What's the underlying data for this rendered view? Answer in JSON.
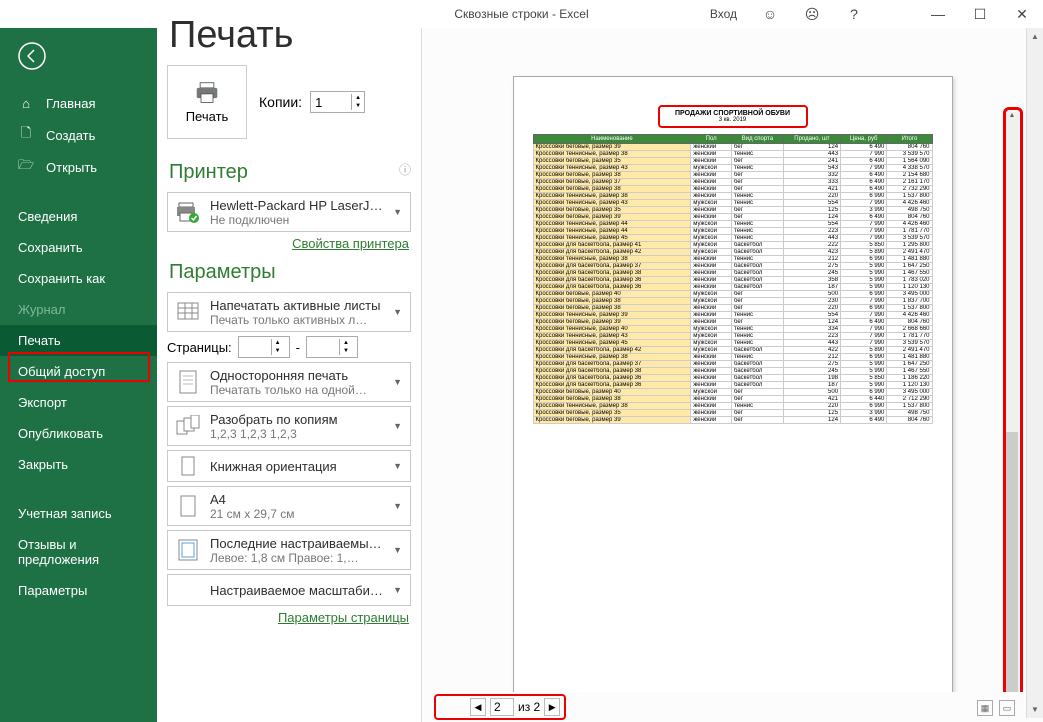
{
  "titlebar": {
    "title": "Сквозные строки - Excel",
    "login": "Вход"
  },
  "sidebar": {
    "home": "Главная",
    "new": "Создать",
    "open": "Открыть",
    "info": "Сведения",
    "save": "Сохранить",
    "saveas": "Сохранить как",
    "history": "Журнал",
    "print": "Печать",
    "share": "Общий доступ",
    "export": "Экспорт",
    "publish": "Опубликовать",
    "close": "Закрыть",
    "account": "Учетная запись",
    "feedback": "Отзывы и предложения",
    "options": "Параметры"
  },
  "page": {
    "title": "Печать"
  },
  "print": {
    "button": "Печать",
    "copies_label": "Копии:",
    "copies": "1"
  },
  "printer_section": "Принтер",
  "printer": {
    "name": "Hewlett-Packard HP LaserJe…",
    "status": "Не подключен",
    "props": "Свойства принтера"
  },
  "params_section": "Параметры",
  "active_sheets": {
    "l1": "Напечатать активные листы",
    "l2": "Печать только активных л…"
  },
  "pages": {
    "label": "Страницы:",
    "dash": "-"
  },
  "one_sided": {
    "l1": "Односторонняя печать",
    "l2": "Печатать только на одной…"
  },
  "collate": {
    "l1": "Разобрать по копиям",
    "l2": "1,2,3   1,2,3   1,2,3"
  },
  "orientation": {
    "l1": "Книжная ориентация"
  },
  "paper": {
    "l1": "A4",
    "l2": "21 см x 29,7 см"
  },
  "margins": {
    "l1": "Последние настраиваемы…",
    "l2": "Левое: 1,8 см  Правое: 1,…"
  },
  "scaling": {
    "l1": "Настраиваемое масштаби…"
  },
  "page_setup_link": "Параметры страницы",
  "preview": {
    "title": "ПРОДАЖИ СПОРТИВНОЙ ОБУВИ",
    "subtitle": "3 кв. 2019",
    "headers": [
      "Наименование",
      "Пол",
      "Вид спорта",
      "Продано, шт",
      "Цена, руб",
      "Итого"
    ],
    "rows": [
      [
        "Кроссовки беговые, размер 39",
        "женский",
        "бег",
        "124",
        "6 490",
        "804 760"
      ],
      [
        "Кроссовки теннисные, размер 38",
        "женский",
        "теннис",
        "443",
        "7 990",
        "3 539 570"
      ],
      [
        "Кроссовки беговые, размер 35",
        "женский",
        "бег",
        "241",
        "6 490",
        "1 564 090"
      ],
      [
        "Кроссовки теннисные, размер 43",
        "мужской",
        "теннис",
        "543",
        "7 990",
        "4 338 570"
      ],
      [
        "Кроссовки беговые, размер 38",
        "женский",
        "бег",
        "332",
        "6 490",
        "2 154 680"
      ],
      [
        "Кроссовки беговые, размер 37",
        "женский",
        "бег",
        "333",
        "6 490",
        "2 161 170"
      ],
      [
        "Кроссовки беговые, размер 38",
        "женский",
        "бег",
        "421",
        "6 490",
        "2 732 290"
      ],
      [
        "Кроссовки теннисные, размер 38",
        "женский",
        "теннис",
        "220",
        "6 990",
        "1 537 800"
      ],
      [
        "Кроссовки теннисные, размер 43",
        "мужской",
        "теннис",
        "554",
        "7 990",
        "4 426 460"
      ],
      [
        "Кроссовки беговые, размер 35",
        "женский",
        "бег",
        "125",
        "3 990",
        "498 750"
      ],
      [
        "Кроссовки беговые, размер 39",
        "женский",
        "бег",
        "124",
        "6 490",
        "804 760"
      ],
      [
        "Кроссовки теннисные, размер 44",
        "мужской",
        "теннис",
        "554",
        "7 990",
        "4 426 460"
      ],
      [
        "Кроссовки теннисные, размер 44",
        "мужской",
        "теннис",
        "223",
        "7 990",
        "1 781 770"
      ],
      [
        "Кроссовки теннисные, размер 45",
        "мужской",
        "теннис",
        "443",
        "7 990",
        "3 539 570"
      ],
      [
        "Кроссовки для баскетбола, размер 41",
        "мужской",
        "баскетбол",
        "222",
        "5 850",
        "1 295 800"
      ],
      [
        "Кроссовки для баскетбола, размер 42",
        "мужской",
        "баскетбол",
        "423",
        "5 890",
        "2 491 470"
      ],
      [
        "Кроссовки теннисные, размер 38",
        "женский",
        "теннис",
        "212",
        "6 990",
        "1 481 880"
      ],
      [
        "Кроссовки для баскетбола, размер 37",
        "женский",
        "баскетбол",
        "275",
        "5 990",
        "1 647 250"
      ],
      [
        "Кроссовки для баскетбола, размер 38",
        "женский",
        "баскетбол",
        "245",
        "5 990",
        "1 467 550"
      ],
      [
        "Кроссовки для баскетбола, размер 36",
        "женский",
        "баскетбол",
        "358",
        "5 990",
        "1 783 020"
      ],
      [
        "Кроссовки для баскетбола, размер 36",
        "женский",
        "баскетбол",
        "187",
        "5 990",
        "1 120 130"
      ],
      [
        "Кроссовки беговые, размер 40",
        "мужской",
        "бег",
        "500",
        "6 990",
        "3 495 000"
      ],
      [
        "Кроссовки беговые, размер 38",
        "мужской",
        "бег",
        "230",
        "7 990",
        "1 837 700"
      ],
      [
        "Кроссовки беговые, размер 38",
        "женский",
        "бег",
        "220",
        "6 990",
        "1 537 800"
      ],
      [
        "Кроссовки теннисные, размер 39",
        "женский",
        "теннис",
        "554",
        "7 990",
        "4 426 460"
      ],
      [
        "Кроссовки беговые, размер 39",
        "женский",
        "бег",
        "124",
        "6 490",
        "804 760"
      ],
      [
        "Кроссовки теннисные, размер 40",
        "мужской",
        "теннис",
        "334",
        "7 990",
        "2 668 660"
      ],
      [
        "Кроссовки теннисные, размер 43",
        "мужской",
        "теннис",
        "223",
        "7 990",
        "1 781 770"
      ],
      [
        "Кроссовки теннисные, размер 45",
        "мужской",
        "теннис",
        "443",
        "7 990",
        "3 539 570"
      ],
      [
        "Кроссовки для баскетбола, размер 42",
        "мужской",
        "баскетбол",
        "422",
        "5 890",
        "2 491 470"
      ],
      [
        "Кроссовки теннисные, размер 38",
        "женский",
        "теннис",
        "212",
        "6 990",
        "1 481 880"
      ],
      [
        "Кроссовки для баскетбола, размер 37",
        "женский",
        "баскетбол",
        "275",
        "5 990",
        "1 647 250"
      ],
      [
        "Кроссовки для баскетбола, размер 38",
        "женский",
        "баскетбол",
        "245",
        "5 990",
        "1 467 550"
      ],
      [
        "Кроссовки для баскетбола, размер 36",
        "женский",
        "баскетбол",
        "198",
        "5 850",
        "1 186 220"
      ],
      [
        "Кроссовки для баскетбола, размер 36",
        "женский",
        "баскетбол",
        "187",
        "5 990",
        "1 120 130"
      ],
      [
        "Кроссовки беговые, размер 40",
        "мужской",
        "бег",
        "500",
        "6 990",
        "3 495 000"
      ],
      [
        "Кроссовки беговые, размер 38",
        "женский",
        "бег",
        "421",
        "6 440",
        "2 712 290"
      ],
      [
        "Кроссовки теннисные, размер 38",
        "женский",
        "теннис",
        "220",
        "6 990",
        "1 537 800"
      ],
      [
        "Кроссовки беговые, размер 35",
        "женский",
        "бег",
        "125",
        "3 990",
        "498 750"
      ],
      [
        "Кроссовки беговые, размер 39",
        "женский",
        "бег",
        "124",
        "6 490",
        "804 760"
      ]
    ]
  },
  "footer": {
    "page": "2",
    "of": "из 2"
  }
}
